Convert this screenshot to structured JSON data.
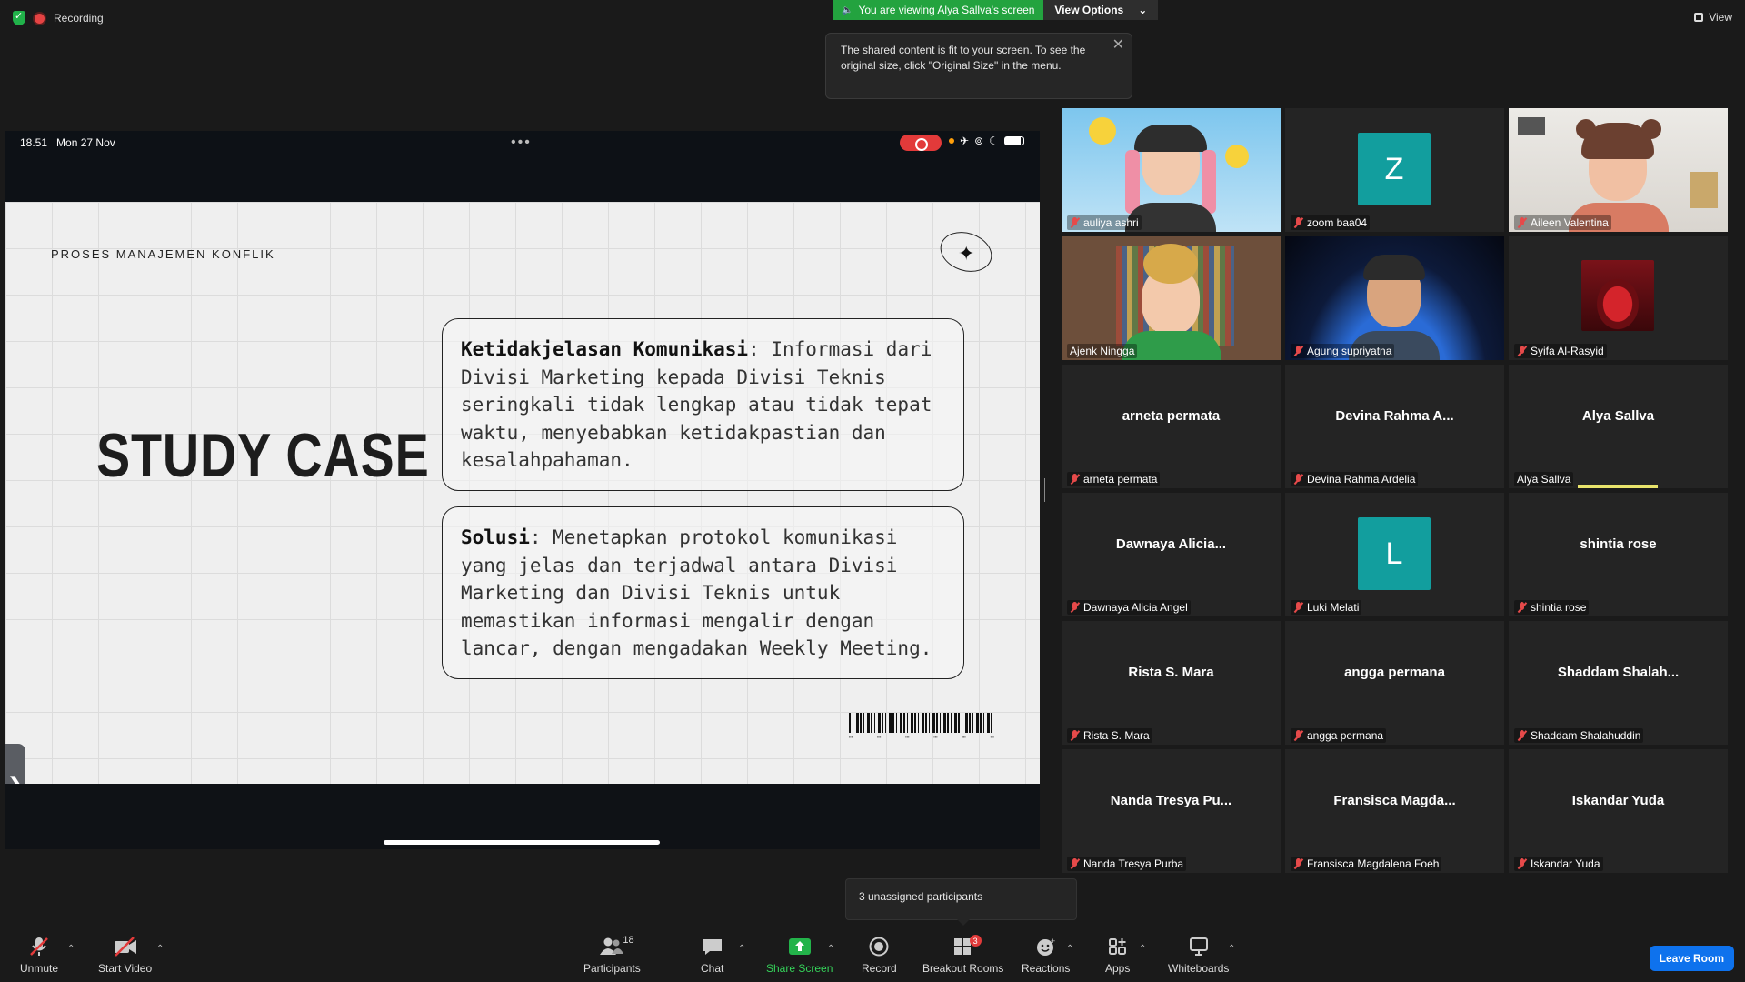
{
  "top": {
    "recording_label": "Recording",
    "viewing_label": "You are viewing Alya Sallva's screen",
    "view_options_label": "View Options",
    "view_label": "View",
    "tooltip_text": "The shared content is fit to your screen. To see the original size, click \"Original Size\" in the menu."
  },
  "ipad": {
    "time": "18.51",
    "date": "Mon 27 Nov"
  },
  "slide": {
    "subtitle": "PROSES MANAJEMEN KONFLIK",
    "title": "STUDY CASE",
    "box1_heading": "Ketidakjelasan Komunikasi",
    "box1_body": ": Informasi dari Divisi Marketing kepada Divisi Teknis seringkali tidak lengkap atau tidak tepat waktu, menyebabkan ketidakpastian dan kesalahpahaman.",
    "box2_heading": "Solusi",
    "box2_body": ": Menetapkan protokol komunikasi yang jelas dan terjadwal antara Divisi Marketing dan Divisi Teknis untuk memastikan informasi mengalir dengan lancar, dengan mengadakan Weekly Meeting."
  },
  "participants": [
    {
      "name": "auliya ashri",
      "muted": true,
      "kind": "avatar"
    },
    {
      "name": "zoom baa04",
      "muted": true,
      "kind": "initial",
      "initial": "Z"
    },
    {
      "name": "Aileen Valentina",
      "muted": true,
      "kind": "avatar"
    },
    {
      "name": "Ajenk Ningga",
      "muted": false,
      "kind": "avatar",
      "active": true
    },
    {
      "name": "Agung supriyatna",
      "muted": true,
      "kind": "avatar"
    },
    {
      "name": "Syifa Al-Rasyid",
      "muted": true,
      "kind": "photo"
    },
    {
      "name": "arneta permata",
      "display": "arneta permata",
      "muted": true,
      "kind": "name"
    },
    {
      "name": "Devina Rahma Ardelia",
      "display": "Devina Rahma A...",
      "muted": true,
      "kind": "name"
    },
    {
      "name": "Alya Sallva",
      "display": "Alya Sallva",
      "muted": false,
      "kind": "name",
      "speaking": true
    },
    {
      "name": "Dawnaya Alicia Angel",
      "display": "Dawnaya Alicia...",
      "muted": true,
      "kind": "name"
    },
    {
      "name": "Luki Melati",
      "muted": true,
      "kind": "initial",
      "initial": "L"
    },
    {
      "name": "shintia rose",
      "display": "shintia rose",
      "muted": true,
      "kind": "name"
    },
    {
      "name": "Rista S. Mara",
      "display": "Rista S. Mara",
      "muted": true,
      "kind": "name"
    },
    {
      "name": "angga permana",
      "display": "angga permana",
      "muted": true,
      "kind": "name"
    },
    {
      "name": "Shaddam Shalahuddin",
      "display": "Shaddam  Shalah...",
      "muted": true,
      "kind": "name"
    },
    {
      "name": "Nanda Tresya Purba",
      "display": "Nanda Tresya Pu...",
      "muted": true,
      "kind": "name"
    },
    {
      "name": "Fransisca Magdalena Foeh",
      "display": "Fransisca  Magda...",
      "muted": true,
      "kind": "name"
    },
    {
      "name": "Iskandar Yuda",
      "display": "Iskandar Yuda",
      "muted": true,
      "kind": "name"
    }
  ],
  "toolbar": {
    "unmute": "Unmute",
    "start_video": "Start Video",
    "participants": "Participants",
    "participants_count": "18",
    "chat": "Chat",
    "share_screen": "Share Screen",
    "record": "Record",
    "breakout_rooms": "Breakout Rooms",
    "breakout_badge": "3",
    "reactions": "Reactions",
    "apps": "Apps",
    "whiteboards": "Whiteboards",
    "leave_room": "Leave Room",
    "unassigned_popup": "3 unassigned participants"
  },
  "colors": {
    "accent_green": "#23a33f",
    "leave_blue": "#0e72ed",
    "active_speaker": "#cbe36b",
    "initial_tile": "#129e9e"
  }
}
